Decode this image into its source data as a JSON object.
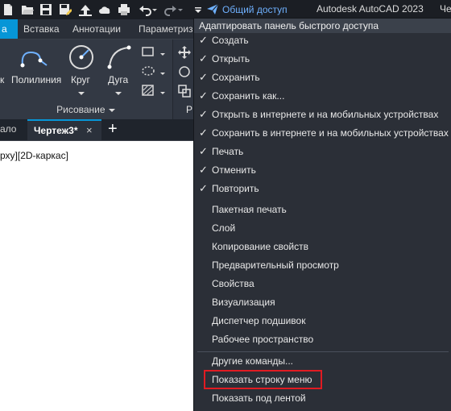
{
  "title_bar": {
    "share_label": "Общий доступ",
    "app_title": "Autodesk AutoCAD 2023",
    "drawing_title_cut": "Черт",
    "qat_icons": [
      "new-icon",
      "open-icon",
      "save-icon",
      "saveas-icon",
      "publish-web-icon",
      "print-icon",
      "undo-icon",
      "redo-icon",
      "qat-dropdown-icon",
      "share-icon"
    ]
  },
  "ribbon": {
    "tabs": [
      "а",
      "Вставка",
      "Аннотации",
      "Параметриз"
    ],
    "tools": [
      "к",
      "Полилиния",
      "Круг",
      "Дуга"
    ],
    "panel_title": "Рисование",
    "panel_right_label": "Р"
  },
  "doc_tabs": {
    "start": "ало",
    "drawing": "Чертеж3*",
    "close": "×",
    "add": "+"
  },
  "viewport": {
    "label": "рху][2D-каркас]"
  },
  "menu": {
    "header": "Адаптировать панель быстрого доступа",
    "check_mark": "✓",
    "items": [
      {
        "label": "Создать",
        "checked": true
      },
      {
        "label": "Открыть",
        "checked": true
      },
      {
        "label": "Сохранить",
        "checked": true
      },
      {
        "label": "Сохранить как...",
        "checked": true
      },
      {
        "label": "Открыть в интернете и на мобильных устройствах",
        "checked": true
      },
      {
        "label": "Сохранить в интернете и на мобильных устройствах",
        "checked": true
      },
      {
        "label": "Печать",
        "checked": true
      },
      {
        "label": "Отменить",
        "checked": true
      },
      {
        "label": "Повторить",
        "checked": true
      },
      {
        "label": "Пакетная печать",
        "checked": false
      },
      {
        "label": "Слой",
        "checked": false
      },
      {
        "label": "Копирование свойств",
        "checked": false
      },
      {
        "label": "Предварительный просмотр",
        "checked": false
      },
      {
        "label": "Свойства",
        "checked": false
      },
      {
        "label": "Визуализация",
        "checked": false
      },
      {
        "label": "Диспетчер подшивок",
        "checked": false
      },
      {
        "label": "Рабочее пространство",
        "checked": false
      },
      {
        "label": "Другие команды...",
        "checked": false
      },
      {
        "label": "Показать строку меню",
        "checked": false
      },
      {
        "label": "Показать под лентой",
        "checked": false
      }
    ]
  },
  "colors": {
    "accent": "#0696d7",
    "highlight": "#e11b22",
    "share": "#6fb1ff"
  }
}
